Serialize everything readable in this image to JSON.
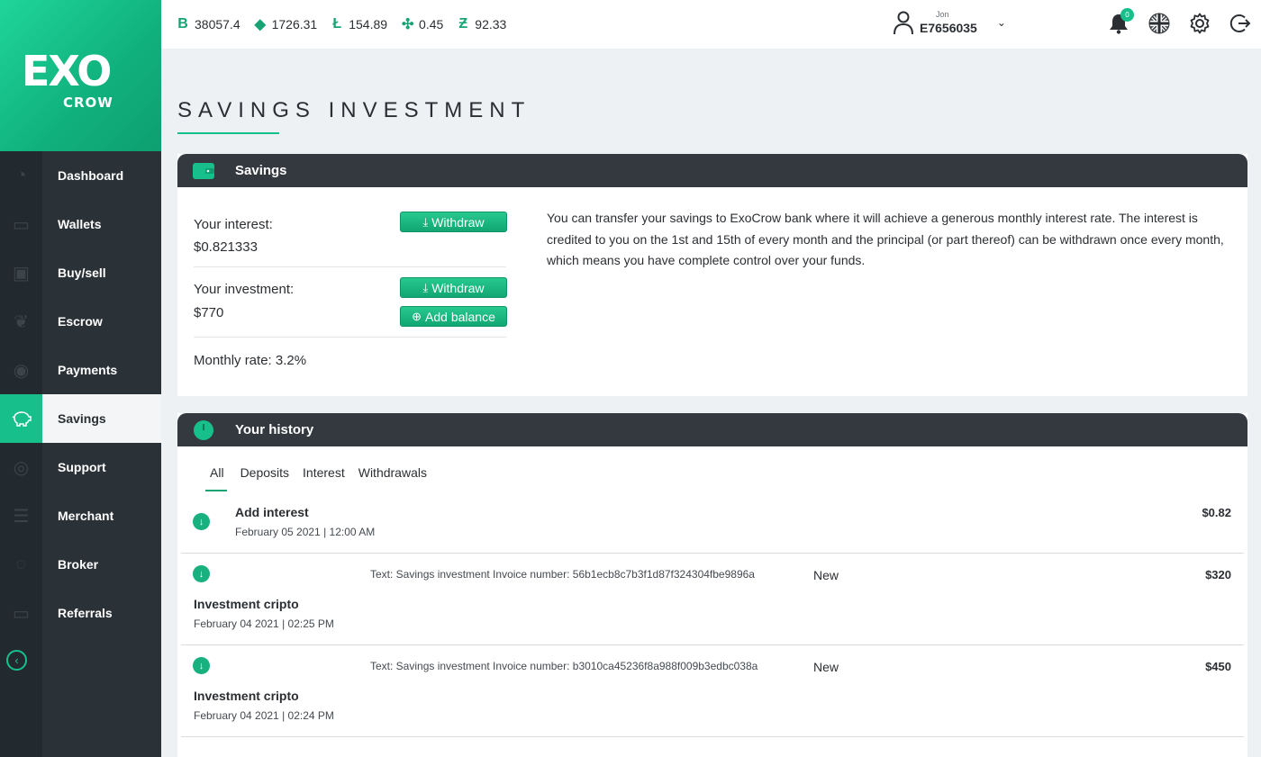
{
  "ticker": [
    {
      "icon": "bitcoin-icon",
      "symbol": "B",
      "value": "38057.4"
    },
    {
      "icon": "ethereum-icon",
      "symbol": "◆",
      "value": "1726.31"
    },
    {
      "icon": "litecoin-icon",
      "symbol": "Ł",
      "value": "154.89"
    },
    {
      "icon": "ripple-icon",
      "symbol": "✣",
      "value": "0.45"
    },
    {
      "icon": "zcash-icon",
      "symbol": "Ƶ",
      "value": "92.33"
    }
  ],
  "user": {
    "name": "Jon",
    "id": "E7656035"
  },
  "notifications": {
    "count": "0"
  },
  "logo": {
    "top": "EXO",
    "bottom": "CROW"
  },
  "nav": [
    {
      "label": "Dashboard",
      "icon": "gauge-icon"
    },
    {
      "label": "Wallets",
      "icon": "wallet-icon"
    },
    {
      "label": "Buy/sell",
      "icon": "exchange-icon"
    },
    {
      "label": "Escrow",
      "icon": "handshake-icon"
    },
    {
      "label": "Payments",
      "icon": "coin-icon"
    },
    {
      "label": "Savings",
      "icon": "piggy-bank-icon"
    },
    {
      "label": "Support",
      "icon": "lifebuoy-icon"
    },
    {
      "label": "Merchant",
      "icon": "sliders-icon"
    },
    {
      "label": "Broker",
      "icon": "broker-icon"
    },
    {
      "label": "Referrals",
      "icon": "referrals-icon"
    }
  ],
  "page_title": "SAVINGS INVESTMENT",
  "savings": {
    "header": "Savings",
    "interest_label": "Your interest:",
    "interest_value": "$0.821333",
    "investment_label": "Your investment:",
    "investment_value": "$770",
    "monthly_rate": "Monthly rate: 3.2%",
    "withdraw_label": "Withdraw",
    "add_balance_label": "Add balance",
    "description": "You can transfer your savings to ExoCrow bank where it will achieve a generous monthly interest rate. The interest is credited to you on the 1st and 15th of every month and the principal (or part thereof) can be withdrawn once every month, which means you have complete control over your funds."
  },
  "history": {
    "header": "Your history",
    "tabs": [
      "All",
      "Deposits",
      "Interest",
      "Withdrawals"
    ],
    "rows": [
      {
        "title": "Add interest",
        "date": "February 05 2021 | 12:00 AM",
        "text": "",
        "status": "",
        "amount": "$0.82"
      },
      {
        "title": "Investment cripto",
        "date": "February 04 2021 | 02:25 PM",
        "text": "Text: Savings investment Invoice number: 56b1ecb8c7b3f1d87f324304fbe9896a",
        "status": "New",
        "amount": "$320"
      },
      {
        "title": "Investment cripto",
        "date": "February 04 2021 | 02:24 PM",
        "text": "Text: Savings investment Invoice number: b3010ca45236f8a988f009b3edbc038a",
        "status": "New",
        "amount": "$450"
      }
    ]
  },
  "colors": {
    "accent": "#17c08a",
    "sidebar": "#2a3137",
    "card_header": "#33393f"
  }
}
